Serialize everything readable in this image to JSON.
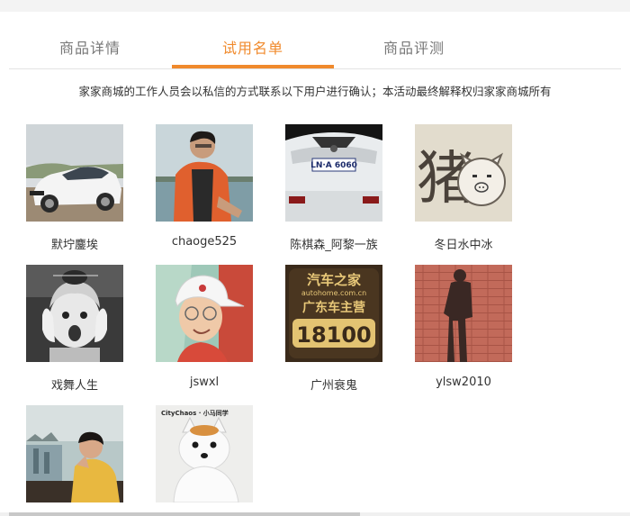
{
  "tabs": [
    {
      "label": "商品详情",
      "active": false
    },
    {
      "label": "试用名单",
      "active": true
    },
    {
      "label": "商品评测",
      "active": false
    }
  ],
  "accent_color": "#f08a2c",
  "notice": "家家商城的工作人员会以私信的方式联系以下用户进行确认；本活动最终解释权归家家商城所有",
  "users": [
    {
      "name": "默坾鏖埃",
      "avatar": "white-car-photo"
    },
    {
      "name": "chaoge525",
      "avatar": "man-in-life-jacket-photo"
    },
    {
      "name": "陈棋森_阿黎一族",
      "avatar": "car-rear-license-plate-photo"
    },
    {
      "name": "冬日水中冰",
      "avatar": "pig-character-drawing"
    },
    {
      "name": "戏舞人生",
      "avatar": "screaming-child-bw-photo"
    },
    {
      "name": "jswxl",
      "avatar": "boy-white-cap-photo"
    },
    {
      "name": "广州衰鬼",
      "avatar": "autohome-badge-18100"
    },
    {
      "name": "ylsw2010",
      "avatar": "shadow-on-brick-photo"
    },
    {
      "name": "",
      "avatar": "young-man-window-photo"
    },
    {
      "name": "",
      "avatar": "white-dog-citychaos-photo"
    }
  ],
  "avatar_texts": {
    "plate": "LN·A 6060",
    "pig_char": "猪",
    "brand_cn": "汽车之家",
    "brand_url": "autohome.com.cn",
    "club": "广东车主营",
    "number": "18100",
    "dog_caption": "CityChaos · 小马同学"
  }
}
